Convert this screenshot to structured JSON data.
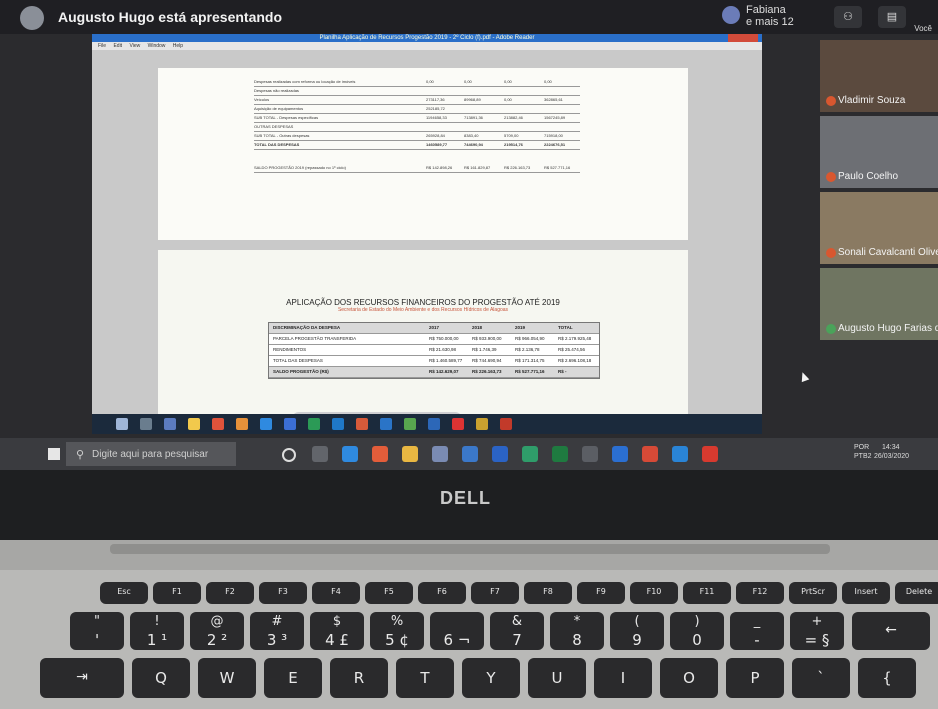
{
  "meeting": {
    "presenter_text": "Augusto Hugo está apresentando",
    "others_line1": "Fabiana",
    "others_line2": "e mais 12",
    "voce_label": "Você"
  },
  "participants": [
    {
      "name": "Vladimir Souza"
    },
    {
      "name": "Paulo Coelho"
    },
    {
      "name": "Sonali Cavalcanti Oliveira"
    },
    {
      "name": "Augusto Hugo Farias da"
    }
  ],
  "pdf": {
    "window_title": "Planilha Aplicação de Recursos Progestão 2019 - 2º Ciclo (f).pdf - Adobe Reader",
    "menu": [
      "File",
      "Edit",
      "View",
      "Window",
      "Help"
    ],
    "page1_rows": [
      {
        "label": "Despesas realizadas com reforma ou locação de imóveis",
        "v1": "0,00",
        "v2": "0,00",
        "v3": "0,00",
        "v4": "0,00"
      },
      {
        "label": "Despesas não realizadas",
        "v1": "",
        "v2": "",
        "v3": "",
        "v4": ""
      },
      {
        "label": "Veículos",
        "v1": "273117,36",
        "v2": "89968,89",
        "v3": "0,00",
        "v4": "362865,61"
      },
      {
        "label": "Aquisição de equipamentos",
        "v1": "252185,72",
        "v2": "",
        "v3": "",
        "v4": ""
      },
      {
        "label": "SUB TOTAL - Despesas específicas",
        "v1": "1194658,33",
        "v2": "713891,36",
        "v3": "213882,46",
        "v4": "1567245,89"
      },
      {
        "label": "OUTRAS DESPESAS",
        "v1": "",
        "v2": "",
        "v3": "",
        "v4": ""
      },
      {
        "label": "SUB TOTAL - Outras despesas",
        "v1": "265928,84",
        "v2": "8383,40",
        "v3": "5709,00",
        "v4": "715918,00"
      },
      {
        "label": "TOTAL DAS DESPESAS",
        "v1": "1460589,77",
        "v2": "744690,94",
        "v3": "219514,76",
        "v4": "2224676,51"
      },
      {
        "label": "SALDO PROGESTÃO 2019 (repassado no 1º ciclo)",
        "v1": "R$ 142.898,26",
        "v2": "R$ 161.829,87",
        "v3": "R$ 226.163,73",
        "v4": "R$ 527.771,16"
      }
    ],
    "page2_title": "APLICAÇÃO DOS RECURSOS FINANCEIROS DO PROGESTÃO ATÉ 2019",
    "page2_subtitle": "Secretaria de Estado do Meio Ambiente e dos Recursos Hídricos de Alagoas",
    "table2": {
      "headers": [
        "DISCRIMINAÇÃO DA DESPESA",
        "2017",
        "2018",
        "2019",
        "TOTAL"
      ],
      "rows": [
        {
          "label": "PARCELA PROGESTÃO TRANSFERIDA",
          "values": [
            "R$ 750.000,00",
            "R$ 933.900,00",
            "R$ 966.054,90",
            "R$ 2.179.925,48"
          ]
        },
        {
          "label": "RENDIMENTOS",
          "values": [
            "R$ 21.630,98",
            "R$ 1.746,39",
            "R$ 2.136,78",
            "R$ 25.474,56"
          ]
        },
        {
          "label": "TOTAL DAS DESPESAS",
          "values": [
            "R$ 1.460.589,77",
            "R$ 744.690,94",
            "R$ 171.314,75",
            "R$ 2.696.108,18"
          ]
        }
      ],
      "saldo_label": "SALDO PROGESTÃO (R$)",
      "saldo_values": [
        "R$ 142.629,07",
        "R$ 226.163,73",
        "R$ 527.771,16",
        "R$ -"
      ]
    }
  },
  "taskbar": {
    "search_placeholder": "Digite aqui para pesquisar",
    "lang": "POR",
    "lang_sub": "PTB2",
    "time": "14:34",
    "date": "26/03/2020"
  },
  "laptop": {
    "brand": "DELL"
  },
  "keys": {
    "fn_row": [
      "Esc",
      "F1",
      "F2",
      "F3",
      "F4",
      "F5",
      "F6",
      "F7",
      "F8",
      "F9",
      "F10",
      "F11",
      "F12",
      "PrtScr",
      "Insert",
      "Delete"
    ],
    "num_row": [
      {
        "top": "\"",
        "bottom": "'"
      },
      {
        "top": "!",
        "bottom": "1 ¹"
      },
      {
        "top": "@",
        "bottom": "2 ²"
      },
      {
        "top": "#",
        "bottom": "3 ³"
      },
      {
        "top": "$",
        "bottom": "4 £"
      },
      {
        "top": "%",
        "bottom": "5 ¢"
      },
      {
        "top": "",
        "bottom": "6 ¬"
      },
      {
        "top": "&",
        "bottom": "7"
      },
      {
        "top": "*",
        "bottom": "8"
      },
      {
        "top": "(",
        "bottom": "9"
      },
      {
        "top": ")",
        "bottom": "0"
      },
      {
        "top": "_",
        "bottom": "-"
      },
      {
        "top": "+",
        "bottom": "= §"
      }
    ],
    "qwerty_row": [
      "Q",
      "W",
      "E",
      "R",
      "T",
      "Y",
      "U",
      "I",
      "O",
      "P",
      "`",
      "{"
    ]
  }
}
